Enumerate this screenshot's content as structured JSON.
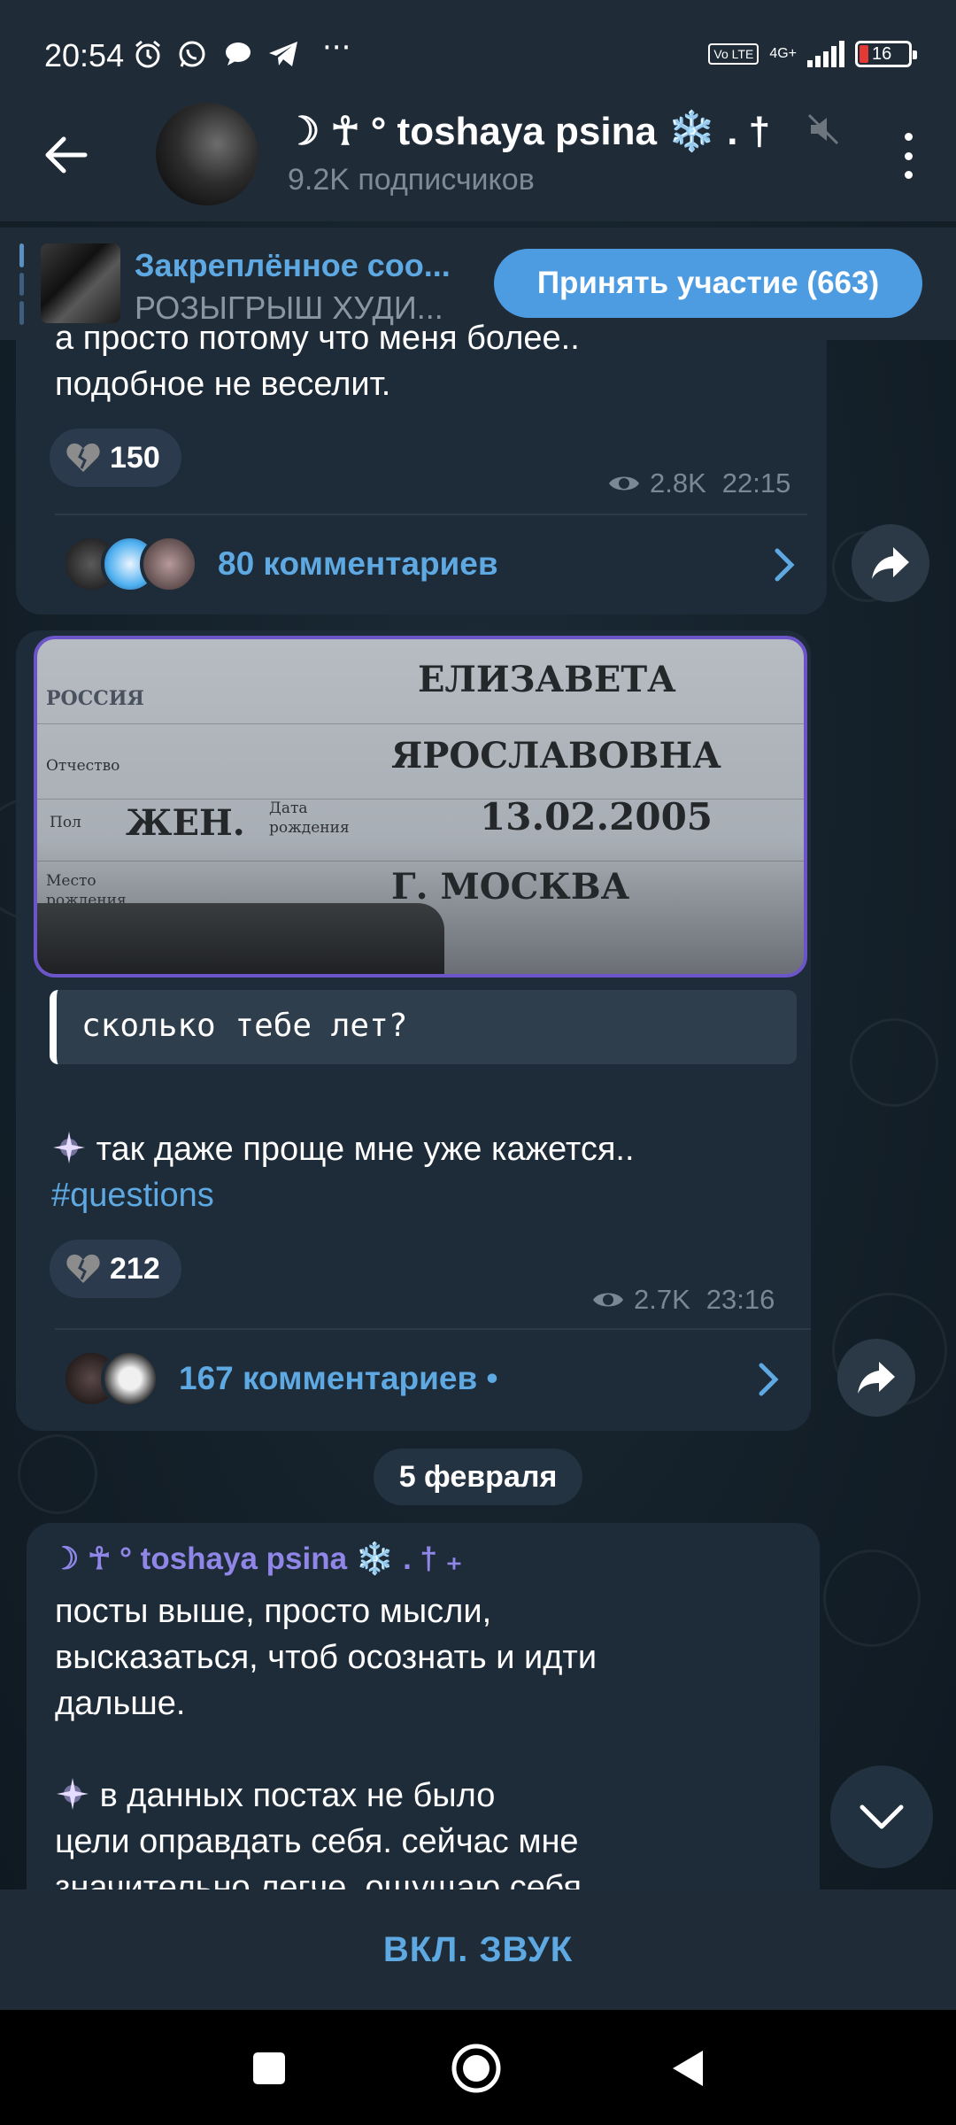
{
  "status_bar": {
    "time": "20:54",
    "network": "4G+",
    "volte": "Vo LTE",
    "battery": "16"
  },
  "header": {
    "title": "☽ ☥ ° toshaya psina ❄️ . †",
    "subtitle": "9.2K подписчиков"
  },
  "pinned": {
    "title": "Закреплённое соо...",
    "text": "РОЗЫГРЫШ ХУДИ...",
    "button": "Принять участие (663)"
  },
  "messages": [
    {
      "text_line1": "а просто потому что меня более..",
      "text_line2": "подобное не веселит.",
      "reaction_count": "150",
      "views": "2.8K",
      "time": "22:15",
      "comments": "80 комментариев"
    },
    {
      "photo_text": {
        "country": "РОССИЯ",
        "name": "ЕЛИЗАВЕТА",
        "patronymic": "ЯРОСЛАВОВНА",
        "sex": "ЖЕН.",
        "birth_date": "13.02.2005",
        "birth_place": "Г. МОСКВА",
        "label_patronymic": "Отчество",
        "label_sex": "Пол",
        "label_dob": "Дата рождения",
        "label_pob": "Место рождения"
      },
      "quote": "сколько тебе лет?",
      "text": "так даже проще мне уже кажется..",
      "hashtag": "#questions",
      "reaction_count": "212",
      "views": "2.7K",
      "time": "23:16",
      "comments": "167 комментариев •"
    },
    {
      "date_chip": "5 февраля",
      "author": "☽ ☥ ° toshaya psina ❄️ . † ₊",
      "line1": "посты выше, просто мысли,",
      "line2": "высказаться, чтоб осознать и идти",
      "line3": "дальше.",
      "line4": "в данных постах не было",
      "line5": "цели оправдать себя. сейчас мне",
      "line6": "значительно легче, ощущаю себя"
    }
  ],
  "sound_bar": {
    "label": "ВКЛ. ЗВУК"
  },
  "colors": {
    "accent": "#5fa9e3",
    "bubble": "#1e2b38",
    "header": "#1f2c38",
    "button": "#4d9be0"
  }
}
